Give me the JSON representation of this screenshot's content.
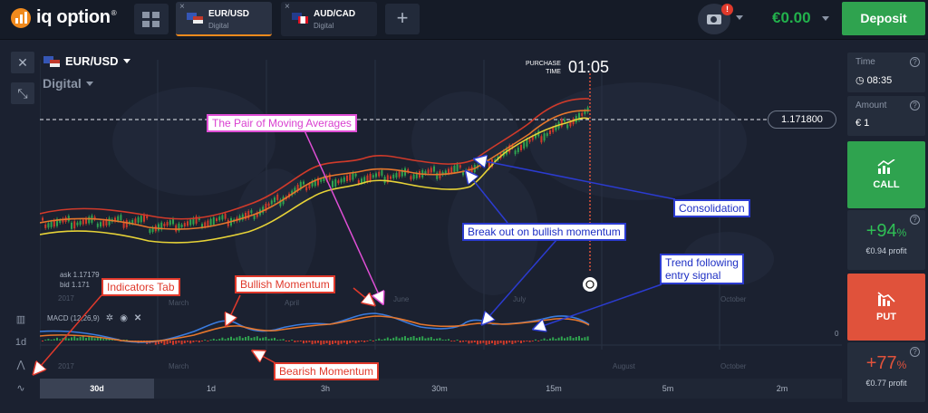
{
  "topbar": {
    "logo_text": "iq option",
    "logo_mark": "®",
    "tabs": [
      {
        "name": "EUR/USD",
        "sub": "Digital",
        "close": "×"
      },
      {
        "name": "AUD/CAD",
        "sub": "Digital",
        "close": "×"
      }
    ],
    "add_label": "+",
    "notification_count": "!",
    "balance": "€0.00",
    "deposit_label": "Deposit"
  },
  "chart_header": {
    "pair": "EUR/USD",
    "type": "Digital",
    "purchase_label_1": "PURCHASE",
    "purchase_label_2": "TIME",
    "purchase_time": "01:05",
    "current_price": "1.171800"
  },
  "left_toolbar": {
    "close_icon": "✕",
    "shrink_icon": "⤡",
    "period": "1d"
  },
  "chart_labels": {
    "ask": "ask 1.17179",
    "bid": "bid 1.171",
    "year_top": "2017",
    "month_march_top": "March",
    "month_april_top": "April",
    "month_june_top": "June",
    "month_july_top": "July",
    "month_october_top": "October",
    "year_bottom": "2017",
    "month_march_bottom": "March",
    "month_august_bottom": "August",
    "month_october_bottom": "October",
    "macd_name": "MACD (12,26,9)",
    "macd_zero": "0"
  },
  "annotations": {
    "moving_averages": "The Pair of Moving Averages",
    "consolidation": "Consolidation",
    "breakout": "Break out on bullish momentum",
    "trend_following_1": "Trend following",
    "trend_following_2": "entry signal",
    "indicators_tab": "Indicators Tab",
    "bullish": "Bullish Momentum",
    "bearish": "Bearish Momentum"
  },
  "right_panel": {
    "time_label": "Time",
    "time_value": "08:35",
    "amount_label": "Amount",
    "amount_value": "€ 1",
    "help": "?",
    "call_label": "CALL",
    "call_pct": "+94",
    "call_profit": "€0.94 profit",
    "put_label": "PUT",
    "put_pct": "+77",
    "put_profit": "€0.77 profit",
    "pct_sign": "%"
  },
  "timeframes": [
    "30d",
    "1d",
    "3h",
    "30m",
    "15m",
    "5m",
    "2m"
  ],
  "colors": {
    "call_green": "#2fa34f",
    "put_red": "#e0523b",
    "brand_orange": "#f08a1d",
    "ma_orange": "#e5762c",
    "ma_red": "#d03a2a",
    "ma_yellow": "#e6d237",
    "macd_blue": "#3a7ce0"
  }
}
